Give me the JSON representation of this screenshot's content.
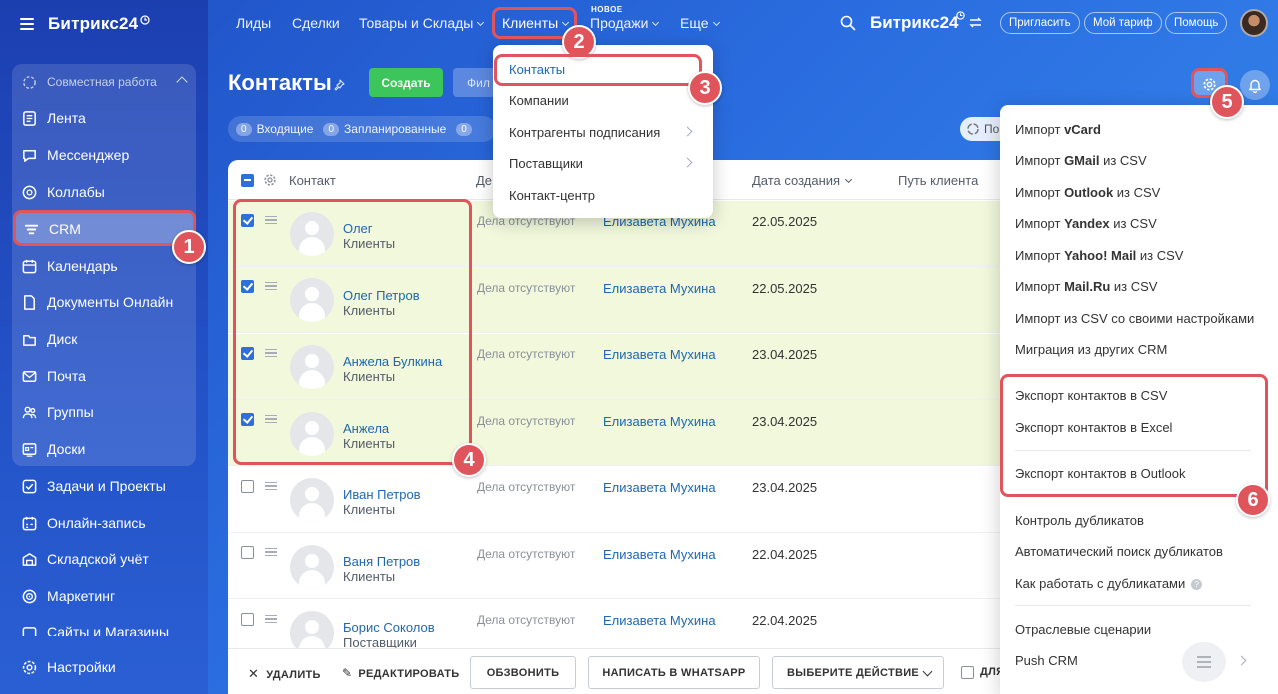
{
  "logo": "Битрикс24",
  "logo_icon": "clock-icon",
  "sidebar": {
    "group_title": "Совместная работа",
    "items": [
      {
        "label": "Лента",
        "icon": "feed-icon"
      },
      {
        "label": "Мессенджер",
        "icon": "chat-icon"
      },
      {
        "label": "Коллабы",
        "icon": "collab-icon"
      },
      {
        "label": "CRM",
        "icon": "crm-icon"
      },
      {
        "label": "Календарь",
        "icon": "calendar-icon"
      },
      {
        "label": "Документы Онлайн",
        "icon": "document-icon"
      },
      {
        "label": "Диск",
        "icon": "disk-icon"
      },
      {
        "label": "Почта",
        "icon": "mail-icon"
      },
      {
        "label": "Группы",
        "icon": "groups-icon"
      },
      {
        "label": "Доски",
        "icon": "boards-icon"
      },
      {
        "label": "Задачи и Проекты",
        "icon": "tasks-icon"
      },
      {
        "label": "Онлайн-запись",
        "icon": "booking-icon"
      },
      {
        "label": "Складской учёт",
        "icon": "warehouse-icon"
      },
      {
        "label": "Маркетинг",
        "icon": "marketing-icon"
      },
      {
        "label": "Сайты и Магазины",
        "icon": "sites-icon"
      },
      {
        "label": "Настройки",
        "icon": "settings-icon"
      }
    ]
  },
  "topnav": {
    "items": [
      "Лиды",
      "Сделки",
      "Товары и Склады",
      "Клиенты",
      "Продажи",
      "Еще"
    ],
    "new_tag": "НОВОЕ",
    "brand": "Битрикс24",
    "invite": "Пригласить",
    "tariff": "Мой тариф",
    "help": "Помощь"
  },
  "page": {
    "title": "Контакты",
    "create": "Создать",
    "filter": "Фил",
    "counters": [
      {
        "num": "0",
        "label": "Входящие"
      },
      {
        "num": "0",
        "label": "Запланированные"
      },
      {
        "num": "0",
        "label": ""
      }
    ],
    "right_pill": "По"
  },
  "table": {
    "headers": {
      "contact": "Контакт",
      "deals": "Де",
      "created": "Дата создания",
      "journey": "Путь клиента"
    },
    "rows": [
      {
        "name": "Олег",
        "type": "Клиенты",
        "activity": "Дела отсутствуют",
        "owner": "Елизавета Мухина",
        "date": "22.05.2025",
        "checked": true
      },
      {
        "name": "Олег Петров",
        "type": "Клиенты",
        "activity": "Дела отсутствуют",
        "owner": "Елизавета Мухина",
        "date": "22.05.2025",
        "checked": true
      },
      {
        "name": "Анжела Булкина",
        "type": "Клиенты",
        "activity": "Дела отсутствуют",
        "owner": "Елизавета Мухина",
        "date": "23.04.2025",
        "checked": true
      },
      {
        "name": "Анжела",
        "type": "Клиенты",
        "activity": "Дела отсутствуют",
        "owner": "Елизавета Мухина",
        "date": "23.04.2025",
        "checked": true
      },
      {
        "name": "Иван Петров",
        "type": "Клиенты",
        "activity": "Дела отсутствуют",
        "owner": "Елизавета Мухина",
        "date": "23.04.2025",
        "checked": false
      },
      {
        "name": "Ваня Петров",
        "type": "Клиенты",
        "activity": "Дела отсутствуют",
        "owner": "Елизавета Мухина",
        "date": "22.04.2025",
        "checked": false
      },
      {
        "name": "Борис Соколов",
        "type": "Поставщики",
        "activity": "Дела отсутствуют",
        "owner": "Елизавета Мухина",
        "date": "22.04.2025",
        "checked": false
      }
    ]
  },
  "bottombar": {
    "delete": "УДАЛИТЬ",
    "edit": "РЕДАКТИРОВАТЬ",
    "call": "ОБЗВОНИТЬ",
    "whatsapp": "НАПИСАТЬ В WHATSAPP",
    "action": "ВЫБЕРИТЕ ДЕЙСТВИЕ",
    "for_all": "ДЛЯ"
  },
  "clients_menu": {
    "items": [
      "Контакты",
      "Компании",
      "Контрагенты подписания",
      "Поставщики",
      "Контакт-центр"
    ]
  },
  "settings_menu": {
    "import": [
      {
        "pre": "Импорт ",
        "bold": "vCard",
        "post": ""
      },
      {
        "pre": "Импорт ",
        "bold": "GMail",
        "post": " из CSV"
      },
      {
        "pre": "Импорт ",
        "bold": "Outlook",
        "post": " из CSV"
      },
      {
        "pre": "Импорт ",
        "bold": "Yandex",
        "post": " из CSV"
      },
      {
        "pre": "Импорт ",
        "bold": "Yahoo! Mail",
        "post": " из CSV"
      },
      {
        "pre": "Импорт ",
        "bold": "Mail.Ru",
        "post": " из CSV"
      }
    ],
    "import_custom": "Импорт из CSV со своими настройками",
    "migration": "Миграция из других CRM",
    "export_csv": "Экспорт контактов в CSV",
    "export_excel": "Экспорт контактов в Excel",
    "export_outlook": "Экспорт контактов в Outlook",
    "dup_control": "Контроль дубликатов",
    "dup_auto": "Автоматический поиск дубликатов",
    "dup_how": "Как работать с дубликатами",
    "industry": "Отраслевые сценарии",
    "push": "Push CRM"
  },
  "annotations": [
    "1",
    "2",
    "3",
    "4",
    "5",
    "6"
  ],
  "colors": {
    "accent": "#2f6fd9",
    "highlight": "#e0555c",
    "create": "#3bc55a",
    "selected_row": "#f1f8dc"
  }
}
